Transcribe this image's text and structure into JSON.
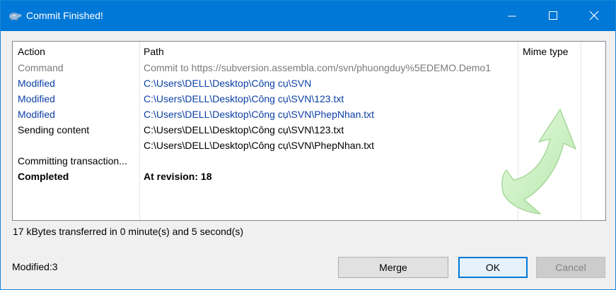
{
  "window": {
    "title": "Commit Finished!",
    "icon": "tortoise-icon",
    "controls": {
      "minimize": "minimize-icon",
      "maximize": "maximize-icon",
      "close": "close-icon"
    }
  },
  "list": {
    "columns": [
      "Action",
      "Path",
      "Mime type"
    ],
    "rows": [
      {
        "action": "Command",
        "path": "Commit to https://subversion.assembla.com/svn/phuongduy%5EDEMO.Demo1",
        "style": "gray"
      },
      {
        "action": "Modified",
        "path": "C:\\Users\\DELL\\Desktop\\Công cụ\\SVN",
        "style": "blue"
      },
      {
        "action": "Modified",
        "path": "C:\\Users\\DELL\\Desktop\\Công cụ\\SVN\\123.txt",
        "style": "blue"
      },
      {
        "action": "Modified",
        "path": "C:\\Users\\DELL\\Desktop\\Công cụ\\SVN\\PhepNhan.txt",
        "style": "blue"
      },
      {
        "action": "Sending content",
        "path": "C:\\Users\\DELL\\Desktop\\Công cụ\\SVN\\123.txt",
        "style": "black"
      },
      {
        "action": "",
        "path": "C:\\Users\\DELL\\Desktop\\Công cụ\\SVN\\PhepNhan.txt",
        "style": "black"
      },
      {
        "action": "Committing transaction...",
        "path": "",
        "style": "black"
      },
      {
        "action": "Completed",
        "path": "At revision: 18",
        "style": "bold"
      }
    ]
  },
  "status": {
    "transfer": "17 kBytes transferred in 0 minute(s) and 5 second(s)",
    "modified": "Modified:3"
  },
  "buttons": {
    "merge": "Merge",
    "ok": "OK",
    "cancel": "Cancel"
  },
  "decor": {
    "arrow_icon": "green-curved-arrow-icon"
  },
  "colors": {
    "titlebar": "#0078d7",
    "modified_text": "#0b3fa6",
    "command_text": "#7a7a7a"
  }
}
